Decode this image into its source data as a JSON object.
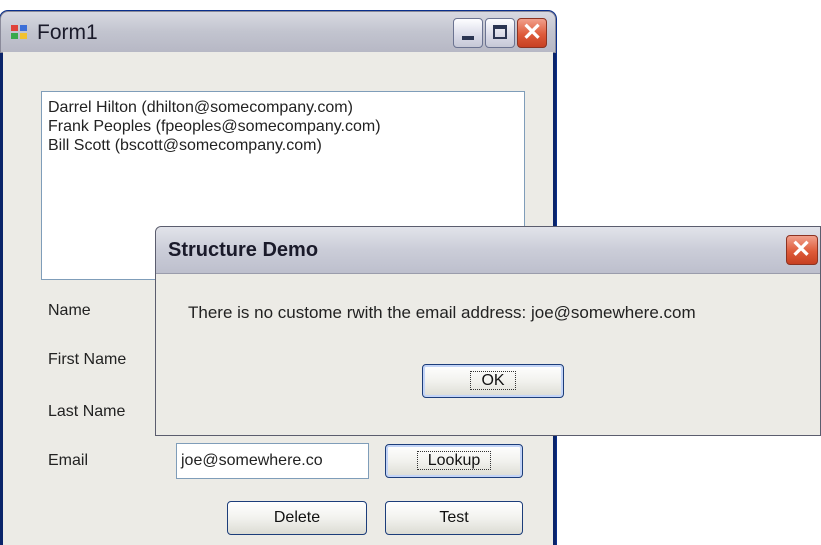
{
  "main_window": {
    "title": "Form1",
    "listbox_items": [
      "Darrel Hilton (dhilton@somecompany.com)",
      "Frank Peoples (fpeoples@somecompany.com)",
      "Bill Scott (bscott@somecompany.com)"
    ],
    "labels": {
      "name": "Name",
      "first_name": "First Name",
      "last_name": "Last Name",
      "email": "Email"
    },
    "email_value": "joe@somewhere.co",
    "buttons": {
      "lookup": "Lookup",
      "delete": "Delete",
      "test": "Test"
    }
  },
  "dialog": {
    "title": "Structure Demo",
    "message": "There is no custome rwith the email address: joe@somewhere.com",
    "ok": "OK"
  },
  "icons": {
    "app": "app-icon",
    "minimize": "minimize-icon",
    "maximize": "maximize-icon",
    "close": "close-icon"
  },
  "colors": {
    "window_bg": "#ecebe6",
    "close_button": "#de5b3a",
    "input_border": "#7f9db9",
    "button_border": "#1c3d7a"
  }
}
